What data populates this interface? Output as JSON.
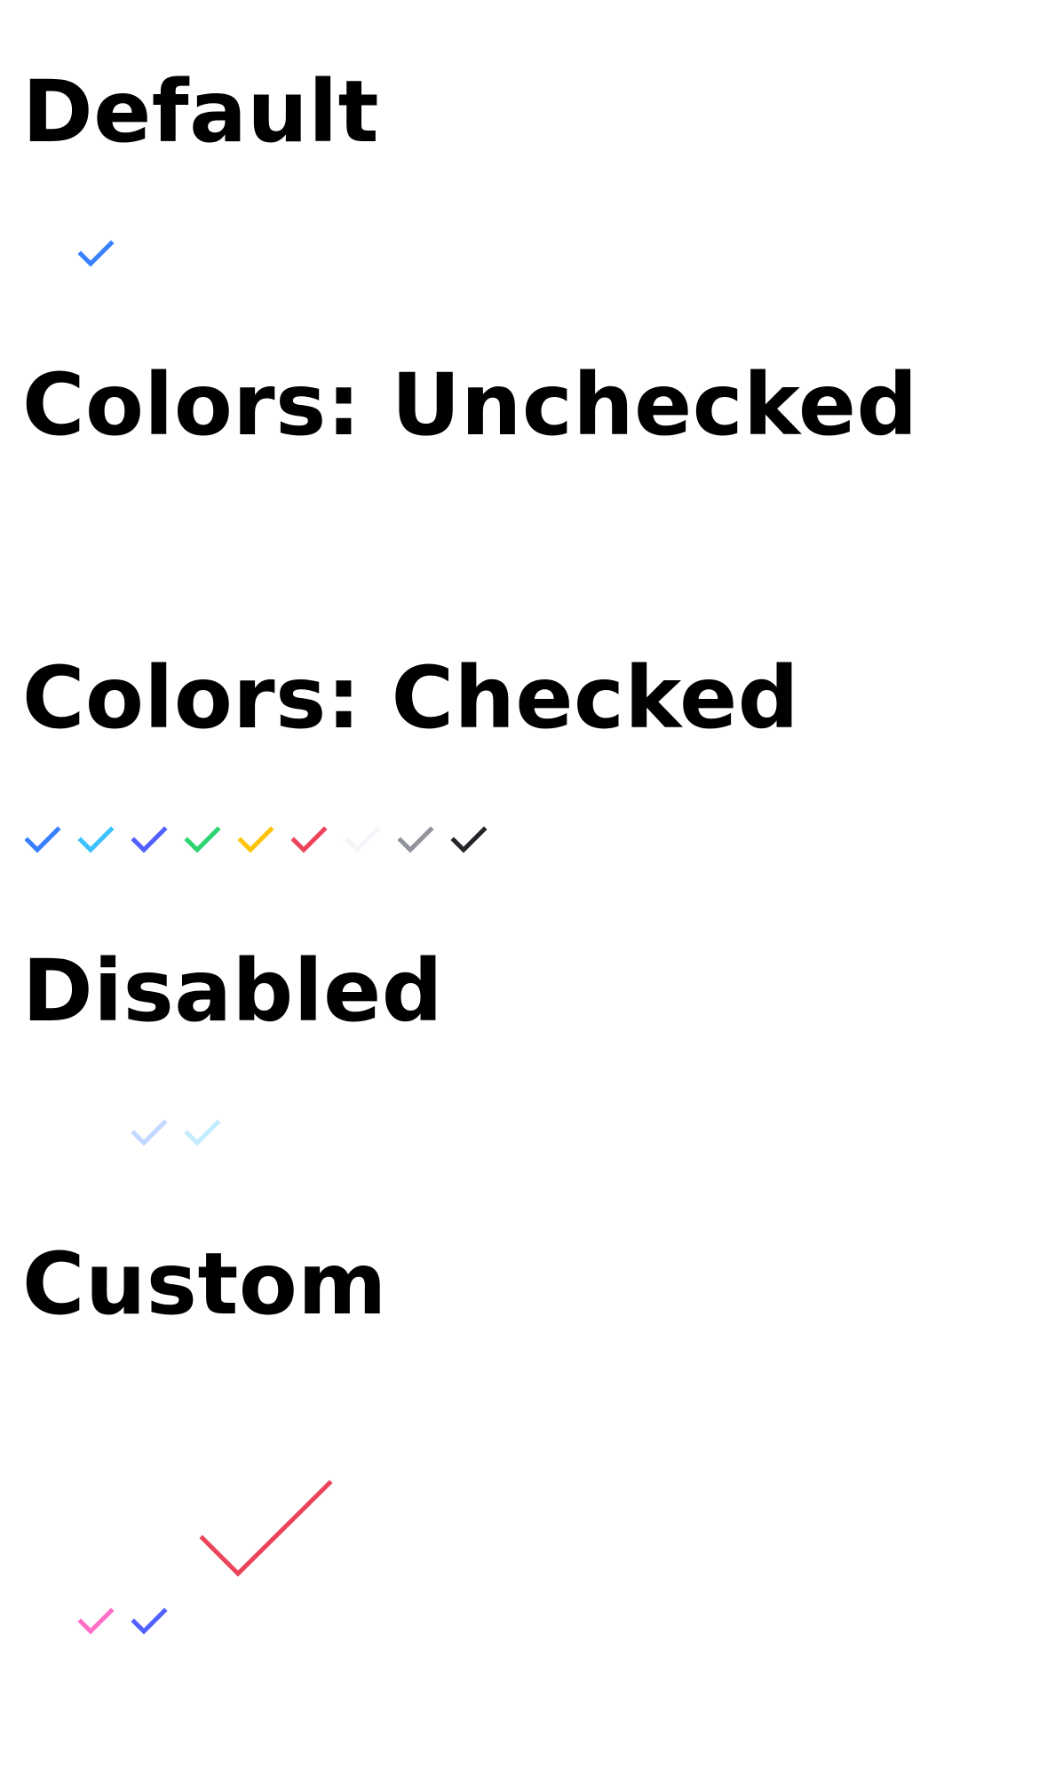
{
  "sections": {
    "default": {
      "title": "Default"
    },
    "unchecked": {
      "title": "Colors: Unchecked"
    },
    "checked": {
      "title": "Colors: Checked"
    },
    "disabled": {
      "title": "Disabled"
    },
    "custom": {
      "title": "Custom"
    }
  },
  "colors": {
    "primary": "#3880ff",
    "secondary": "#3dc2ff",
    "tertiary": "#5260ff",
    "success": "#2dd36f",
    "warning": "#ffc409",
    "danger": "#eb445a",
    "light": "#f4f5f8",
    "medium": "#92949c",
    "dark": "#222428",
    "pink": "#ff6ec7",
    "disabled_primary": "#c3d8ff",
    "disabled_secondary": "#c4ecff"
  },
  "checkmarks": {
    "default": {
      "color": "primary",
      "state": "checked"
    },
    "checked_row": [
      "primary",
      "secondary",
      "tertiary",
      "success",
      "warning",
      "danger",
      "light",
      "medium",
      "dark"
    ],
    "disabled_row": [
      "disabled_primary",
      "disabled_secondary"
    ],
    "custom": [
      "pink",
      "tertiary",
      "danger"
    ]
  }
}
